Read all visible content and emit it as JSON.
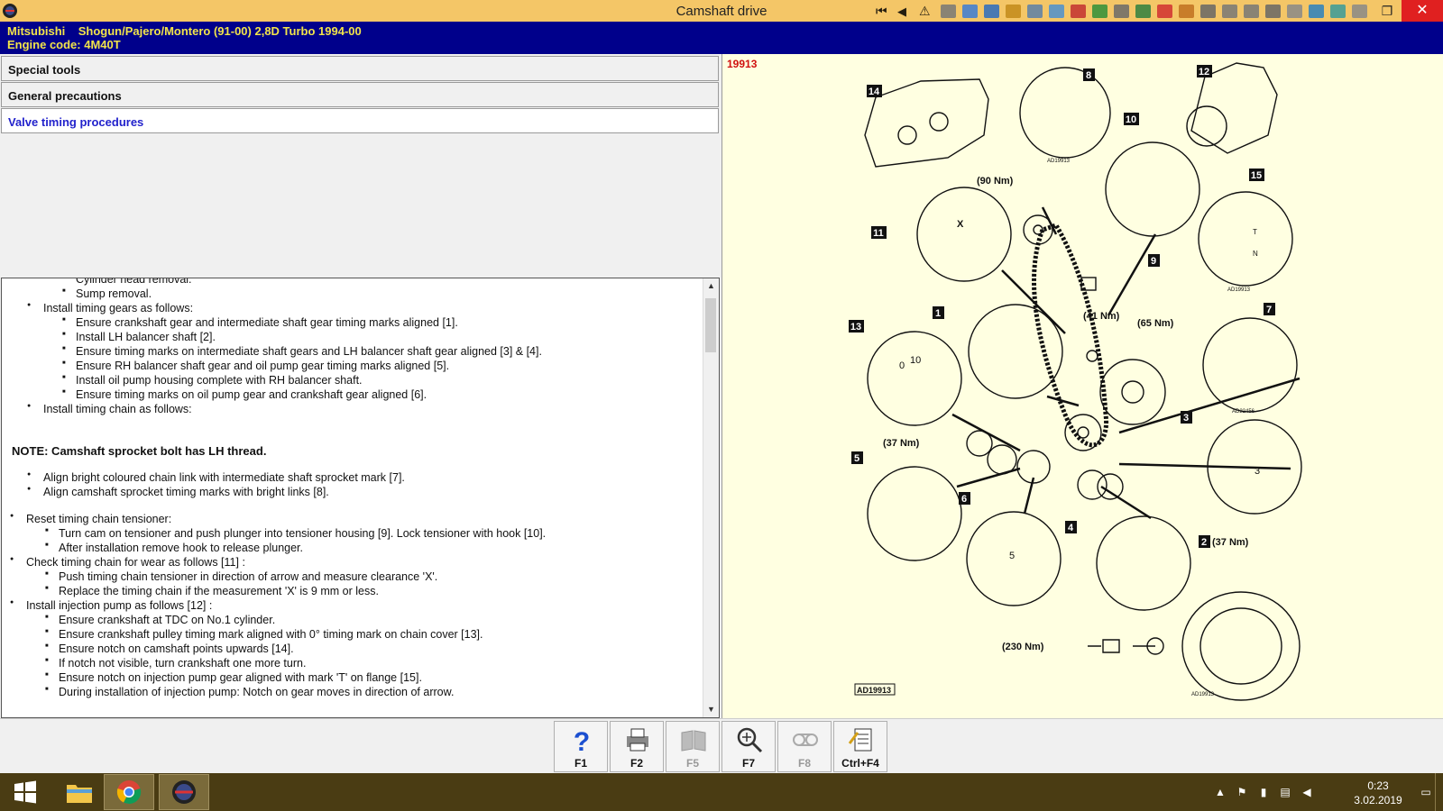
{
  "window": {
    "title": "Camshaft drive"
  },
  "toolbar": {
    "icons": [
      "first-page-icon",
      "previous-icon",
      "warning-icon",
      "document-icon",
      "picture-icon",
      "engine-icon",
      "tools-icon",
      "gauge-icon",
      "diagram-icon",
      "checklist-icon",
      "book-icon",
      "settings-icon",
      "wrench-icon",
      "circuit-icon",
      "list-icon",
      "car-icon",
      "car-front-icon",
      "car-side-icon",
      "engine-diagram-icon",
      "oil-icon",
      "wheel-icon",
      "tyre-icon",
      "clipboard-icon"
    ]
  },
  "vehicle": {
    "make": "Mitsubishi",
    "model": "Shogun/Pajero/Montero (91-00) 2,8D Turbo 1994-00",
    "engine_code": "Engine code: 4M40T"
  },
  "menu": {
    "items": [
      {
        "label": "Special tools"
      },
      {
        "label": "General precautions"
      },
      {
        "label": "Valve timing procedures"
      }
    ]
  },
  "procedure": {
    "lines": [
      {
        "text": "Cylinder head removal.",
        "level": 2
      },
      {
        "text": "Sump removal.",
        "level": 2
      },
      {
        "text": "Install timing gears as follows:",
        "level": 1
      },
      {
        "text": "Ensure crankshaft gear and intermediate shaft gear timing marks aligned [1].",
        "level": 2
      },
      {
        "text": "Install LH balancer shaft [2].",
        "level": 2
      },
      {
        "text": "Ensure timing marks on intermediate shaft gears and LH balancer shaft gear aligned [3] & [4].",
        "level": 2
      },
      {
        "text": "Ensure RH balancer shaft gear and oil pump gear timing marks aligned [5].",
        "level": 2
      },
      {
        "text": "Install oil pump housing complete with RH balancer shaft.",
        "level": 2
      },
      {
        "text": "Ensure timing marks on oil pump gear and crankshaft gear aligned [6].",
        "level": 2
      },
      {
        "text": "Install timing chain as follows:",
        "level": 1
      },
      {
        "text": "NOTE: Camshaft sprocket bolt has LH thread.",
        "level": 0
      },
      {
        "text": "Align bright coloured chain link with intermediate shaft sprocket mark [7].",
        "level": 1
      },
      {
        "text": "Align camshaft sprocket timing marks with bright links [8].",
        "level": 1
      },
      {
        "text": "Reset timing chain tensioner:",
        "level": 1
      },
      {
        "text": "Turn cam on tensioner and push plunger into tensioner housing [9]. Lock tensioner with hook [10].",
        "level": 2
      },
      {
        "text": "After installation remove hook to release plunger.",
        "level": 2
      },
      {
        "text": "Check timing chain for wear as follows [11] :",
        "level": 1
      },
      {
        "text": "Push timing chain tensioner in direction of arrow and measure clearance 'X'.",
        "level": 2
      },
      {
        "text": "Replace the timing chain if the measurement 'X' is 9 mm or less.",
        "level": 2
      },
      {
        "text": "Install injection pump as follows [12] :",
        "level": 1
      },
      {
        "text": "Ensure crankshaft at TDC on No.1 cylinder.",
        "level": 2
      },
      {
        "text": "Ensure crankshaft pulley timing mark aligned with 0° timing mark on chain cover [13].",
        "level": 2
      },
      {
        "text": "Ensure notch on camshaft points upwards [14].",
        "level": 2
      },
      {
        "text": "If notch not visible, turn crankshaft one more turn.",
        "level": 2
      },
      {
        "text": "Ensure notch on injection pump gear aligned with mark 'T' on flange [15].",
        "level": 2
      },
      {
        "text": "During installation of injection pump: Notch on gear moves in direction of arrow.",
        "level": 2
      }
    ]
  },
  "diagram": {
    "ref_number": "19913",
    "figure_code": "AD19913",
    "sub_code": "AD19913",
    "sub_code_alt": "AD22456",
    "callouts": [
      "1",
      "2",
      "3",
      "4",
      "5",
      "6",
      "7",
      "8",
      "9",
      "10",
      "11",
      "12",
      "13",
      "14",
      "15"
    ],
    "torques": {
      "cam": "(90 Nm)",
      "tensioner": "(41 Nm)",
      "idler": "(65 Nm)",
      "balancer_left": "(37 Nm)",
      "balancer_right": "(37 Nm)",
      "crank_bolt": "(230 Nm)"
    },
    "gauge_marks": {
      "zero": "0",
      "ten": "10"
    },
    "flange_marks": {
      "t": "T",
      "n": "N"
    },
    "gear_marks": {
      "three": "3",
      "five": "5"
    },
    "chain_gap": "X"
  },
  "fkeys": [
    {
      "label": "F1",
      "icon": "help-icon",
      "enabled": true
    },
    {
      "label": "F2",
      "icon": "printer-icon",
      "enabled": true
    },
    {
      "label": "F5",
      "icon": "book-icon",
      "enabled": false
    },
    {
      "label": "F7",
      "icon": "zoom-icon",
      "enabled": true
    },
    {
      "label": "F8",
      "icon": "chain-icon",
      "enabled": false
    },
    {
      "label": "Ctrl+F4",
      "icon": "notes-icon",
      "enabled": true
    }
  ],
  "taskbar": {
    "apps": [
      "start-icon",
      "file-explorer-icon",
      "chrome-icon",
      "autodata-icon"
    ],
    "clock_time": "0:23",
    "clock_date": "3.02.2019"
  },
  "colors": {
    "titlebar": "#f4c667",
    "header_bg": "#00008b",
    "header_text": "#f2e44a",
    "diagram_bg": "#ffffe1",
    "ref_red": "#d01010",
    "active_link": "#2222cc"
  }
}
